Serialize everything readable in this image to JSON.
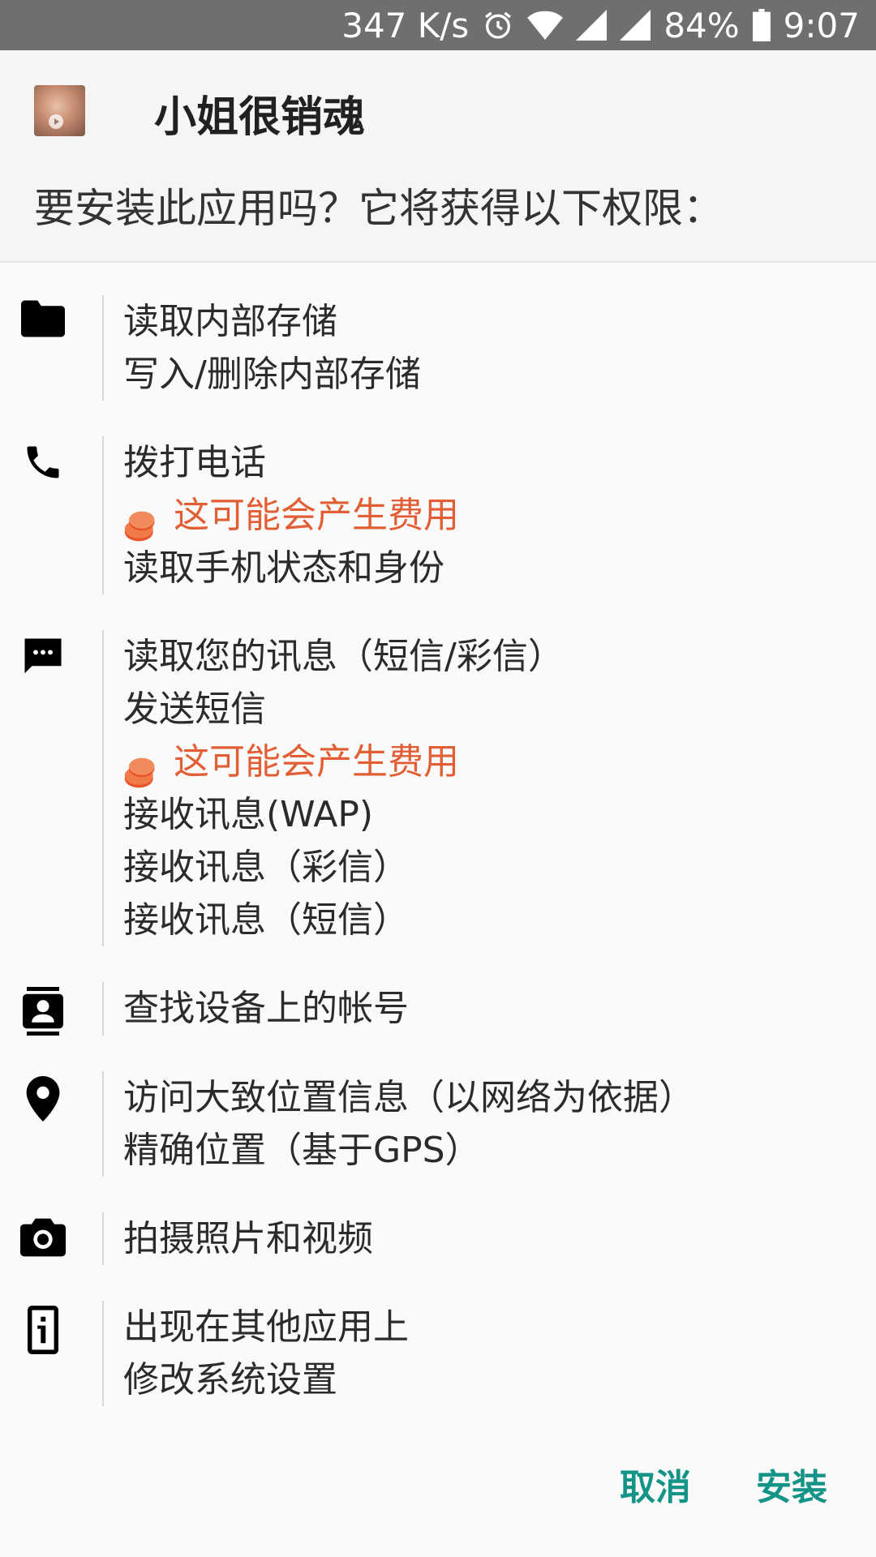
{
  "status_bar": {
    "network_speed": "347 K/s",
    "battery_percent": "84%",
    "time": "9:07",
    "icons": [
      "alarm-icon",
      "wifi-icon",
      "signal-icon",
      "signal-icon",
      "battery-icon"
    ]
  },
  "header": {
    "app_name": "小姐很销魂",
    "install_question": "要安装此应用吗？它将获得以下权限："
  },
  "permissions": [
    {
      "icon": "folder-icon",
      "lines": [
        {
          "text": "读取内部存储"
        },
        {
          "text": "写入/删除内部存储"
        }
      ]
    },
    {
      "icon": "phone-icon",
      "lines": [
        {
          "text": "拨打电话"
        },
        {
          "text": "这可能会产生费用",
          "cost": true
        },
        {
          "text": "读取手机状态和身份"
        }
      ]
    },
    {
      "icon": "message-icon",
      "lines": [
        {
          "text": "读取您的讯息（短信/彩信）"
        },
        {
          "text": "发送短信"
        },
        {
          "text": "这可能会产生费用",
          "cost": true
        },
        {
          "text": "接收讯息(WAP)"
        },
        {
          "text": "接收讯息（彩信）"
        },
        {
          "text": "接收讯息（短信）"
        }
      ]
    },
    {
      "icon": "contacts-icon",
      "lines": [
        {
          "text": "查找设备上的帐号"
        }
      ]
    },
    {
      "icon": "location-icon",
      "lines": [
        {
          "text": "访问大致位置信息（以网络为依据）"
        },
        {
          "text": "精确位置（基于GPS）"
        }
      ]
    },
    {
      "icon": "camera-icon",
      "lines": [
        {
          "text": "拍摄照片和视频"
        }
      ]
    },
    {
      "icon": "overlay-info-icon",
      "lines": [
        {
          "text": "出现在其他应用上"
        },
        {
          "text": "修改系统设置"
        }
      ]
    }
  ],
  "buttons": {
    "cancel": "取消",
    "install": "安装"
  },
  "colors": {
    "accent": "#139487",
    "cost_text": "#e25f35",
    "status_bar": "#6f6f6f"
  }
}
